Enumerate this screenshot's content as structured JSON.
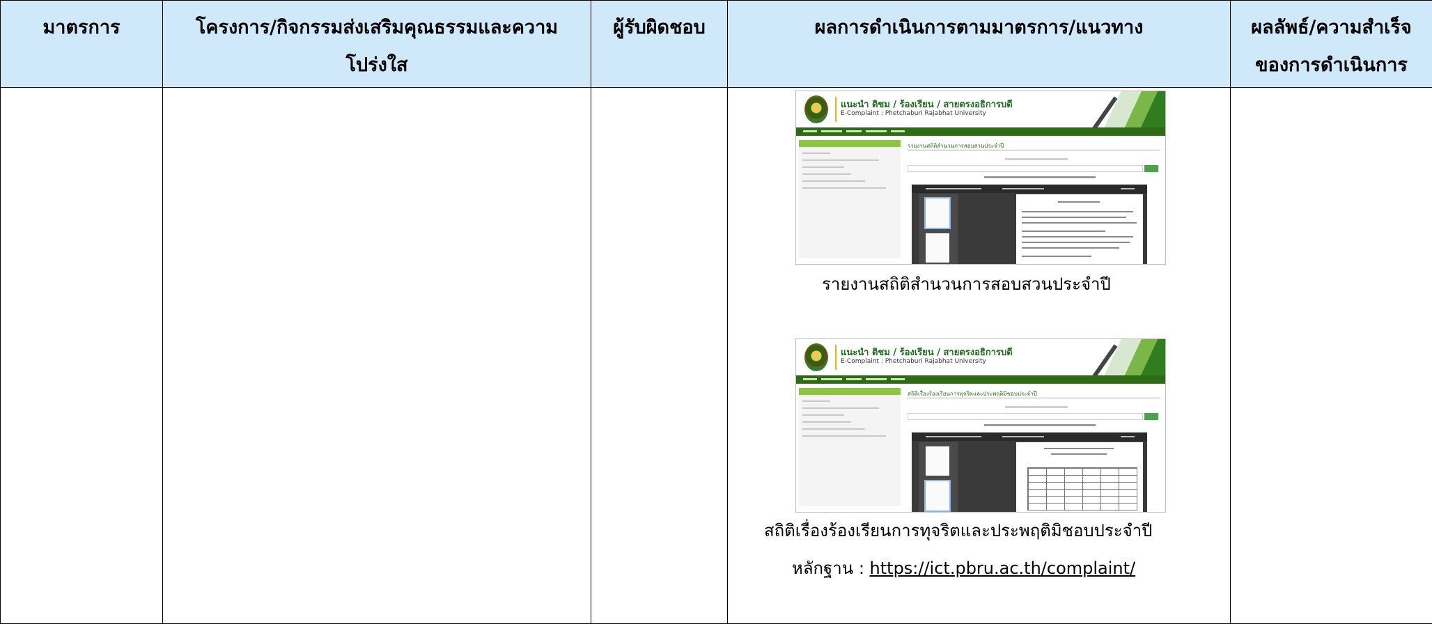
{
  "headers": {
    "col1": "มาตรการ",
    "col2_line1": "โครงการ/กิจกรรมส่งเสริมคุณธรรมและความ",
    "col2_line2": "โปร่งใส",
    "col3": "ผู้รับผิดชอบ",
    "col4": "ผลการดำเนินการตามมาตรการ/แนวทาง",
    "col5_line1": "ผลลัพธ์/ความสำเร็จ",
    "col5_line2": "ของการดำเนินการ"
  },
  "screenshots": [
    {
      "site_title": "แนะนำ ติชม / ร้องเรียน / สายตรงอธิการบดี",
      "site_subtitle": "E-Complaint : Phetchaburi Rajabhat University",
      "page_heading": "รายงานสถิติสำนวนการสอบสวนประจำปี"
    },
    {
      "site_title": "แนะนำ ติชม / ร้องเรียน / สายตรงอธิการบดี",
      "site_subtitle": "E-Complaint : Phetchaburi Rajabhat University",
      "page_heading": "สถิติเรื่องร้องเรียนการทุจริตและประพฤติมิชอบประจำปี"
    }
  ],
  "captions": {
    "first": "รายงานสถิติสำนวนการสอบสวนประจำปี",
    "second": "สถิติเรื่องร้องเรียนการทุจริตและประพฤติมิชอบประจำปี",
    "evidence_label": "หลักฐาน : ",
    "evidence_link": "https://ict.pbru.ac.th/complaint/"
  },
  "colors": {
    "header_bg": "#cfe9fb",
    "site_green": "#2f6a14",
    "accent_green": "#8cc63f"
  }
}
